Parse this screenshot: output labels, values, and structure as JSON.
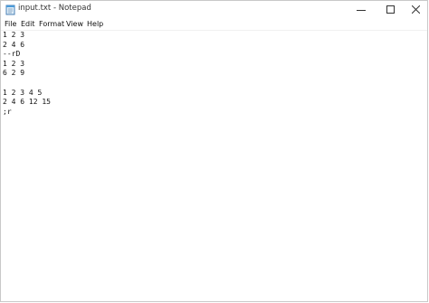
{
  "window": {
    "title": "input.txt - Notepad"
  },
  "icons": {
    "app": "notepad-icon",
    "minimize": "minimize-icon",
    "maximize": "maximize-icon",
    "close": "close-icon"
  },
  "menu": {
    "file": "File",
    "edit": "Edit",
    "format": "Format",
    "view": "View",
    "help": "Help"
  },
  "editor": {
    "lines": [
      "1 2 3",
      "2 4 6",
      "--rD",
      "1 2 3",
      "6 2 9",
      "",
      "1 2 3 4 5",
      "2 4 6 12 15",
      ";r"
    ]
  }
}
